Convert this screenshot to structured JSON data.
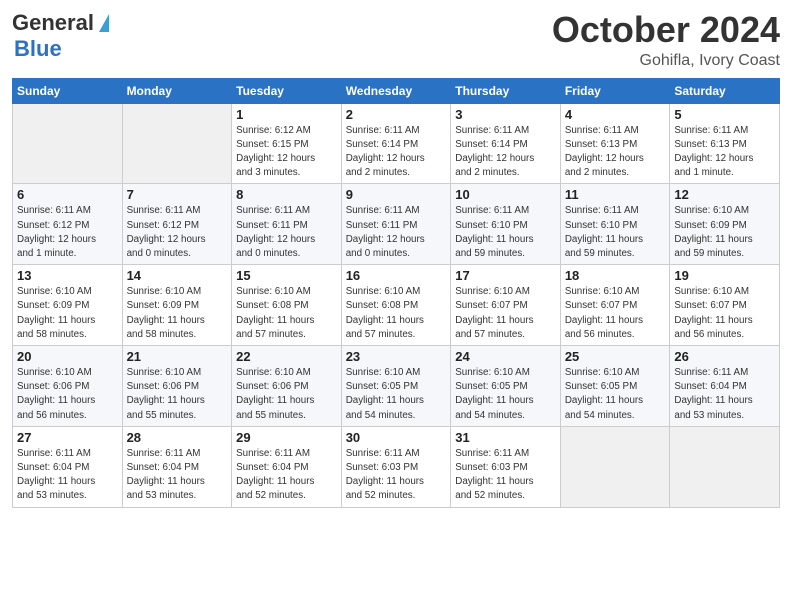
{
  "header": {
    "logo_line1": "General",
    "logo_line2": "Blue",
    "month": "October 2024",
    "location": "Gohifla, Ivory Coast"
  },
  "weekdays": [
    "Sunday",
    "Monday",
    "Tuesday",
    "Wednesday",
    "Thursday",
    "Friday",
    "Saturday"
  ],
  "weeks": [
    [
      {
        "day": "",
        "detail": ""
      },
      {
        "day": "",
        "detail": ""
      },
      {
        "day": "1",
        "detail": "Sunrise: 6:12 AM\nSunset: 6:15 PM\nDaylight: 12 hours\nand 3 minutes."
      },
      {
        "day": "2",
        "detail": "Sunrise: 6:11 AM\nSunset: 6:14 PM\nDaylight: 12 hours\nand 2 minutes."
      },
      {
        "day": "3",
        "detail": "Sunrise: 6:11 AM\nSunset: 6:14 PM\nDaylight: 12 hours\nand 2 minutes."
      },
      {
        "day": "4",
        "detail": "Sunrise: 6:11 AM\nSunset: 6:13 PM\nDaylight: 12 hours\nand 2 minutes."
      },
      {
        "day": "5",
        "detail": "Sunrise: 6:11 AM\nSunset: 6:13 PM\nDaylight: 12 hours\nand 1 minute."
      }
    ],
    [
      {
        "day": "6",
        "detail": "Sunrise: 6:11 AM\nSunset: 6:12 PM\nDaylight: 12 hours\nand 1 minute."
      },
      {
        "day": "7",
        "detail": "Sunrise: 6:11 AM\nSunset: 6:12 PM\nDaylight: 12 hours\nand 0 minutes."
      },
      {
        "day": "8",
        "detail": "Sunrise: 6:11 AM\nSunset: 6:11 PM\nDaylight: 12 hours\nand 0 minutes."
      },
      {
        "day": "9",
        "detail": "Sunrise: 6:11 AM\nSunset: 6:11 PM\nDaylight: 12 hours\nand 0 minutes."
      },
      {
        "day": "10",
        "detail": "Sunrise: 6:11 AM\nSunset: 6:10 PM\nDaylight: 11 hours\nand 59 minutes."
      },
      {
        "day": "11",
        "detail": "Sunrise: 6:11 AM\nSunset: 6:10 PM\nDaylight: 11 hours\nand 59 minutes."
      },
      {
        "day": "12",
        "detail": "Sunrise: 6:10 AM\nSunset: 6:09 PM\nDaylight: 11 hours\nand 59 minutes."
      }
    ],
    [
      {
        "day": "13",
        "detail": "Sunrise: 6:10 AM\nSunset: 6:09 PM\nDaylight: 11 hours\nand 58 minutes."
      },
      {
        "day": "14",
        "detail": "Sunrise: 6:10 AM\nSunset: 6:09 PM\nDaylight: 11 hours\nand 58 minutes."
      },
      {
        "day": "15",
        "detail": "Sunrise: 6:10 AM\nSunset: 6:08 PM\nDaylight: 11 hours\nand 57 minutes."
      },
      {
        "day": "16",
        "detail": "Sunrise: 6:10 AM\nSunset: 6:08 PM\nDaylight: 11 hours\nand 57 minutes."
      },
      {
        "day": "17",
        "detail": "Sunrise: 6:10 AM\nSunset: 6:07 PM\nDaylight: 11 hours\nand 57 minutes."
      },
      {
        "day": "18",
        "detail": "Sunrise: 6:10 AM\nSunset: 6:07 PM\nDaylight: 11 hours\nand 56 minutes."
      },
      {
        "day": "19",
        "detail": "Sunrise: 6:10 AM\nSunset: 6:07 PM\nDaylight: 11 hours\nand 56 minutes."
      }
    ],
    [
      {
        "day": "20",
        "detail": "Sunrise: 6:10 AM\nSunset: 6:06 PM\nDaylight: 11 hours\nand 56 minutes."
      },
      {
        "day": "21",
        "detail": "Sunrise: 6:10 AM\nSunset: 6:06 PM\nDaylight: 11 hours\nand 55 minutes."
      },
      {
        "day": "22",
        "detail": "Sunrise: 6:10 AM\nSunset: 6:06 PM\nDaylight: 11 hours\nand 55 minutes."
      },
      {
        "day": "23",
        "detail": "Sunrise: 6:10 AM\nSunset: 6:05 PM\nDaylight: 11 hours\nand 54 minutes."
      },
      {
        "day": "24",
        "detail": "Sunrise: 6:10 AM\nSunset: 6:05 PM\nDaylight: 11 hours\nand 54 minutes."
      },
      {
        "day": "25",
        "detail": "Sunrise: 6:10 AM\nSunset: 6:05 PM\nDaylight: 11 hours\nand 54 minutes."
      },
      {
        "day": "26",
        "detail": "Sunrise: 6:11 AM\nSunset: 6:04 PM\nDaylight: 11 hours\nand 53 minutes."
      }
    ],
    [
      {
        "day": "27",
        "detail": "Sunrise: 6:11 AM\nSunset: 6:04 PM\nDaylight: 11 hours\nand 53 minutes."
      },
      {
        "day": "28",
        "detail": "Sunrise: 6:11 AM\nSunset: 6:04 PM\nDaylight: 11 hours\nand 53 minutes."
      },
      {
        "day": "29",
        "detail": "Sunrise: 6:11 AM\nSunset: 6:04 PM\nDaylight: 11 hours\nand 52 minutes."
      },
      {
        "day": "30",
        "detail": "Sunrise: 6:11 AM\nSunset: 6:03 PM\nDaylight: 11 hours\nand 52 minutes."
      },
      {
        "day": "31",
        "detail": "Sunrise: 6:11 AM\nSunset: 6:03 PM\nDaylight: 11 hours\nand 52 minutes."
      },
      {
        "day": "",
        "detail": ""
      },
      {
        "day": "",
        "detail": ""
      }
    ]
  ]
}
